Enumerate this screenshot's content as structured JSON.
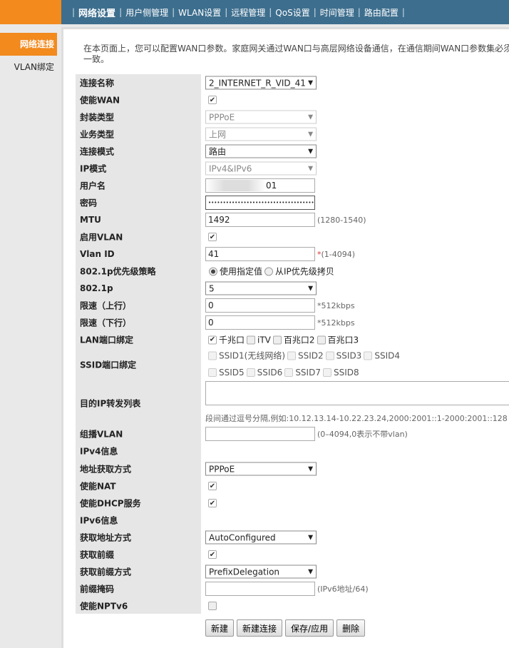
{
  "nav": [
    "网络设置",
    "用户侧管理",
    "WLAN设置",
    "远程管理",
    "QoS设置",
    "时间管理",
    "路由配置"
  ],
  "sidebar": [
    "网络连接",
    "VLAN绑定"
  ],
  "intro": [
    "在本页面上，您可以配置WAN口参数。家庭网关通过WAN口与高层网络设备通信，在通信期间WAN口参数集必须",
    "一致。"
  ],
  "labels": {
    "conn_name": "连接名称",
    "enable_wan": "使能WAN",
    "encap": "封装类型",
    "service": "业务类型",
    "mode": "连接模式",
    "ipmode": "IP模式",
    "user": "用户名",
    "pass": "密码",
    "mtu": "MTU",
    "vlan_en": "启用VLAN",
    "vlan_id": "Vlan ID",
    "prio_policy": "802.1p优先级策略",
    "p8021": "802.1p",
    "up": "限速（上行）",
    "down": "限速（下行）",
    "lan_bind": "LAN端口绑定",
    "ssid_bind": "SSID端口绑定",
    "dest_ip": "目的IP转发列表",
    "mcast": "组播VLAN",
    "ipv4": "IPv4信息",
    "v4addr": "地址获取方式",
    "nat": "使能NAT",
    "dhcp": "使能DHCP服务",
    "ipv6": "IPv6信息",
    "v6addr": "获取地址方式",
    "prefix": "获取前缀",
    "prefix_mode": "获取前缀方式",
    "prefix_mask": "前缀掩码",
    "nptv6": "使能NPTv6"
  },
  "values": {
    "conn_name": "2_INTERNET_R_VID_41",
    "encap": "PPPoE",
    "service": "上网",
    "mode": "路由",
    "ipmode": "IPv4&IPv6",
    "user": "01",
    "pass": "••••••••••••••••••••••••••••••••••••",
    "mtu": "1492",
    "mtu_hint": "(1280-1540)",
    "vlan_id": "41",
    "vlan_hint": "(1-4094)",
    "prio_opt1": "使用指定值",
    "prio_opt2": "从IP优先级拷贝",
    "p8021": "5",
    "up": "0",
    "down": "0",
    "rate_hint": "*512kbps",
    "lan": [
      "千兆口",
      "iTV",
      "百兆口2",
      "百兆口3"
    ],
    "ssid": [
      "SSID1(无线网络)",
      "SSID2",
      "SSID3",
      "SSID4",
      "SSID5",
      "SSID6",
      "SSID7",
      "SSID8"
    ],
    "dest_hint": "段间通过逗号分隔,例如:10.12.13.14-10.22.23.24,2000:2001::1-2000:2001::128",
    "mcast": "",
    "mcast_hint": "(0–4094,0表示不带vlan)",
    "v4addr": "PPPoE",
    "v6addr": "AutoConfigured",
    "prefix_mode": "PrefixDelegation",
    "prefix_mask": "",
    "prefix_hint": "(IPv6地址/64)"
  },
  "buttons": [
    "新建",
    "新建连接",
    "保存/应用",
    "删除"
  ]
}
